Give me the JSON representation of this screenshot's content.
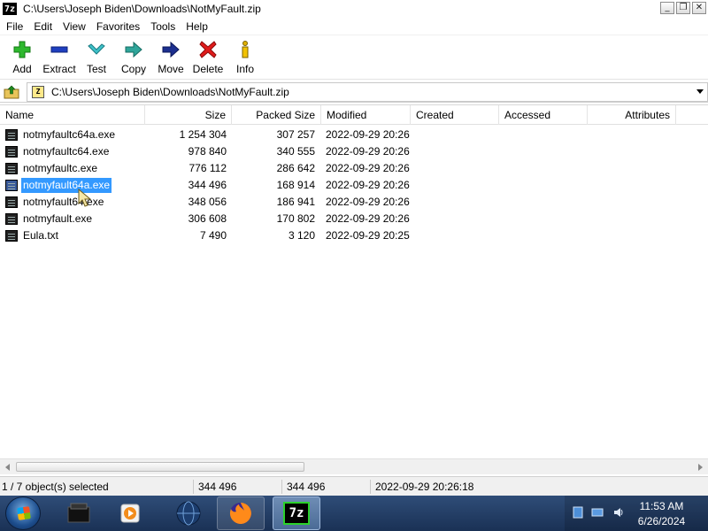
{
  "window": {
    "title": "C:\\Users\\Joseph Biden\\Downloads\\NotMyFault.zip",
    "app_icon_text": "7z",
    "controls": {
      "minimize": "_",
      "restore": "❐",
      "close": "✕"
    }
  },
  "menu": [
    "File",
    "Edit",
    "View",
    "Favorites",
    "Tools",
    "Help"
  ],
  "toolbar": {
    "add": "Add",
    "extract": "Extract",
    "test": "Test",
    "copy": "Copy",
    "move": "Move",
    "delete": "Delete",
    "info": "Info"
  },
  "address": {
    "path": "C:\\Users\\Joseph Biden\\Downloads\\NotMyFault.zip",
    "zip_icon_text": "Z"
  },
  "columns": {
    "name": "Name",
    "size": "Size",
    "packed": "Packed Size",
    "modified": "Modified",
    "created": "Created",
    "accessed": "Accessed",
    "attributes": "Attributes"
  },
  "files": [
    {
      "name": "notmyfaultc64a.exe",
      "size": "1 254 304",
      "packed": "307 257",
      "modified": "2022-09-29 20:26",
      "selected": false
    },
    {
      "name": "notmyfaultc64.exe",
      "size": "978 840",
      "packed": "340 555",
      "modified": "2022-09-29 20:26",
      "selected": false
    },
    {
      "name": "notmyfaultc.exe",
      "size": "776 112",
      "packed": "286 642",
      "modified": "2022-09-29 20:26",
      "selected": false
    },
    {
      "name": "notmyfault64a.exe",
      "size": "344 496",
      "packed": "168 914",
      "modified": "2022-09-29 20:26",
      "selected": true
    },
    {
      "name": "notmyfault64.exe",
      "size": "348 056",
      "packed": "186 941",
      "modified": "2022-09-29 20:26",
      "selected": false
    },
    {
      "name": "notmyfault.exe",
      "size": "306 608",
      "packed": "170 802",
      "modified": "2022-09-29 20:26",
      "selected": false
    },
    {
      "name": "Eula.txt",
      "size": "7 490",
      "packed": "3 120",
      "modified": "2022-09-29 20:25",
      "selected": false
    }
  ],
  "status": {
    "selection": "1 / 7 object(s) selected",
    "size": "344 496",
    "packed": "344 496",
    "modified": "2022-09-29 20:26:18"
  },
  "taskbar": {
    "apps": [
      "explorer",
      "media-player",
      "globe",
      "firefox",
      "7-zip"
    ],
    "sevenzip_label": "7z",
    "time": "11:53 AM",
    "date": "6/26/2024"
  }
}
